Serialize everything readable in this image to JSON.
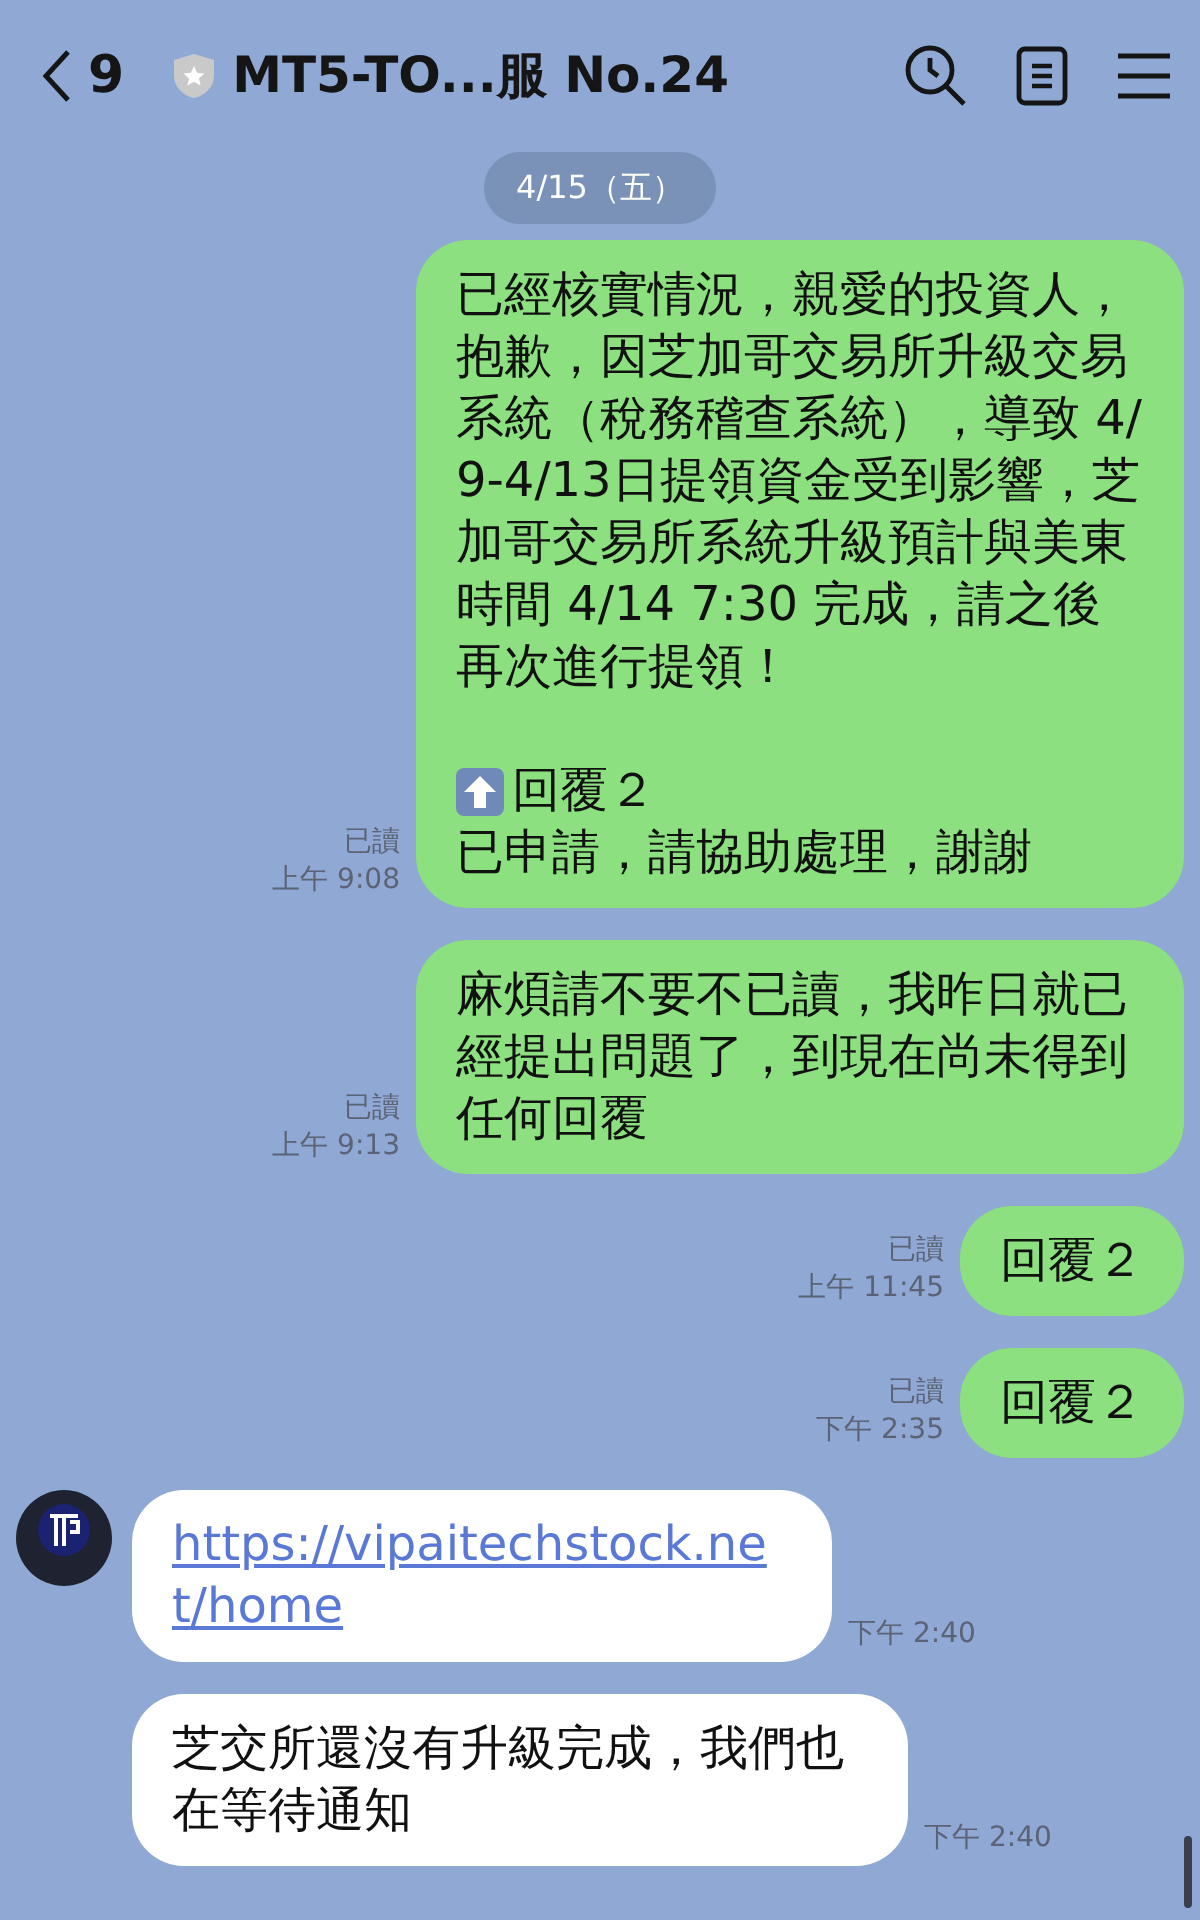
{
  "header": {
    "back_count": "9",
    "title": "MT5-TO...服 No.24"
  },
  "date_pill": "4/15（五）",
  "messages": [
    {
      "kind": "sent",
      "text": "已經核實情況，親愛的投資人，抱歉，因芝加哥交易所升級交易系統（稅務稽查系統），導致 4/9-4/13日提領資金受到影響，芝加哥交易所系統升級預計與美東時間 4/14 7:30 完成，請之後再次進行提領！",
      "reply_label": "回覆２",
      "tail": "已申請，請協助處理，謝謝",
      "read": "已讀",
      "time": "上午 9:08"
    },
    {
      "kind": "sent",
      "text": "麻煩請不要不已讀，我昨日就已經提出問題了，到現在尚未得到任何回覆",
      "read": "已讀",
      "time": "上午 9:13"
    },
    {
      "kind": "sent",
      "text": "回覆２",
      "read": "已讀",
      "time": "上午 11:45"
    },
    {
      "kind": "sent",
      "text": "回覆２",
      "read": "已讀",
      "time": "下午 2:35"
    },
    {
      "kind": "link",
      "text": "https://vipaitechstock.net/home",
      "time": "下午 2:40"
    },
    {
      "kind": "received",
      "text": "芝交所還沒有升級完成，我們也在等待通知",
      "time": "下午 2:40"
    }
  ]
}
